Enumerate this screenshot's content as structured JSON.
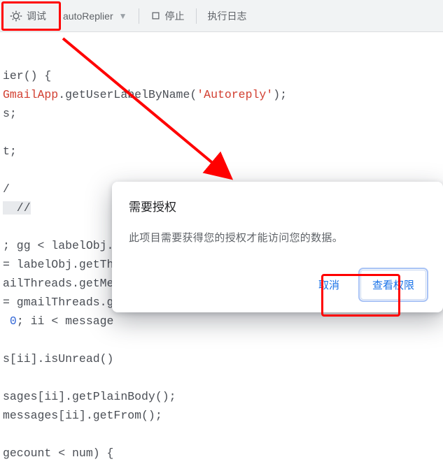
{
  "toolbar": {
    "debug_label": "调试",
    "function_name": "autoReplier",
    "stop_label": "停止",
    "log_label": "执行日志"
  },
  "code": {
    "l1_a": "ier() {",
    "l2_a": "GmailApp",
    "l2_b": ".getUserLabelByName(",
    "l2_c": "'Autoreply'",
    "l2_d": ");",
    "l3": "s;",
    "l4": "t;",
    "l5": "/",
    "l6": "  //",
    "l7": "; gg < labelObj.",
    "l8": "= labelObj.getTh",
    "l9": "ailThreads.getMe",
    "l10": "= gmailThreads.g",
    "l11_a": " ",
    "l11_b": "0",
    "l11_c": "; ii < message",
    "l12": "s[ii].isUnread()",
    "l13": "sages[ii].getPlainBody();",
    "l14": "messages[ii].getFrom();",
    "l15": "gecount < num) {"
  },
  "dialog": {
    "title": "需要授权",
    "body": "此项目需要获得您的授权才能访问您的数据。",
    "cancel": "取消",
    "confirm": "查看权限"
  }
}
